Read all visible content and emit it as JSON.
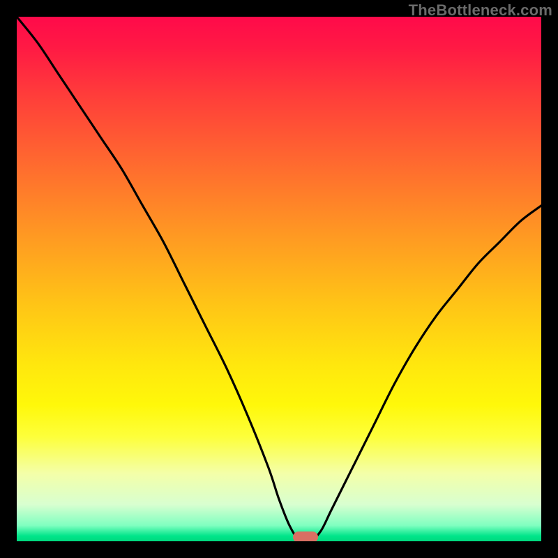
{
  "watermark": "TheBottleneck.com",
  "colors": {
    "frame": "#000000",
    "curve": "#000000",
    "marker": "#d96f63",
    "gradient_top": "#ff0a4a",
    "gradient_bottom": "#00d97e"
  },
  "chart_data": {
    "type": "line",
    "title": "",
    "xlabel": "",
    "ylabel": "",
    "xlim": [
      0,
      100
    ],
    "ylim": [
      0,
      100
    ],
    "x": [
      0,
      4,
      8,
      12,
      16,
      20,
      24,
      28,
      32,
      36,
      40,
      44,
      48,
      50,
      52,
      54,
      56,
      58,
      60,
      64,
      68,
      72,
      76,
      80,
      84,
      88,
      92,
      96,
      100
    ],
    "values": [
      100,
      95,
      89,
      83,
      77,
      71,
      64,
      57,
      49,
      41,
      33,
      24,
      14,
      8,
      3,
      0,
      0,
      2,
      6,
      14,
      22,
      30,
      37,
      43,
      48,
      53,
      57,
      61,
      64
    ],
    "minimum_marker": {
      "x": 55,
      "y": 0
    },
    "notes": "V-shaped bottleneck curve; minimum near x≈55% indicating balanced configuration. Background gradient encodes severity (red=high bottleneck, green=none). Values estimated from pixel heights; no numeric axis ticks are shown in the image."
  }
}
